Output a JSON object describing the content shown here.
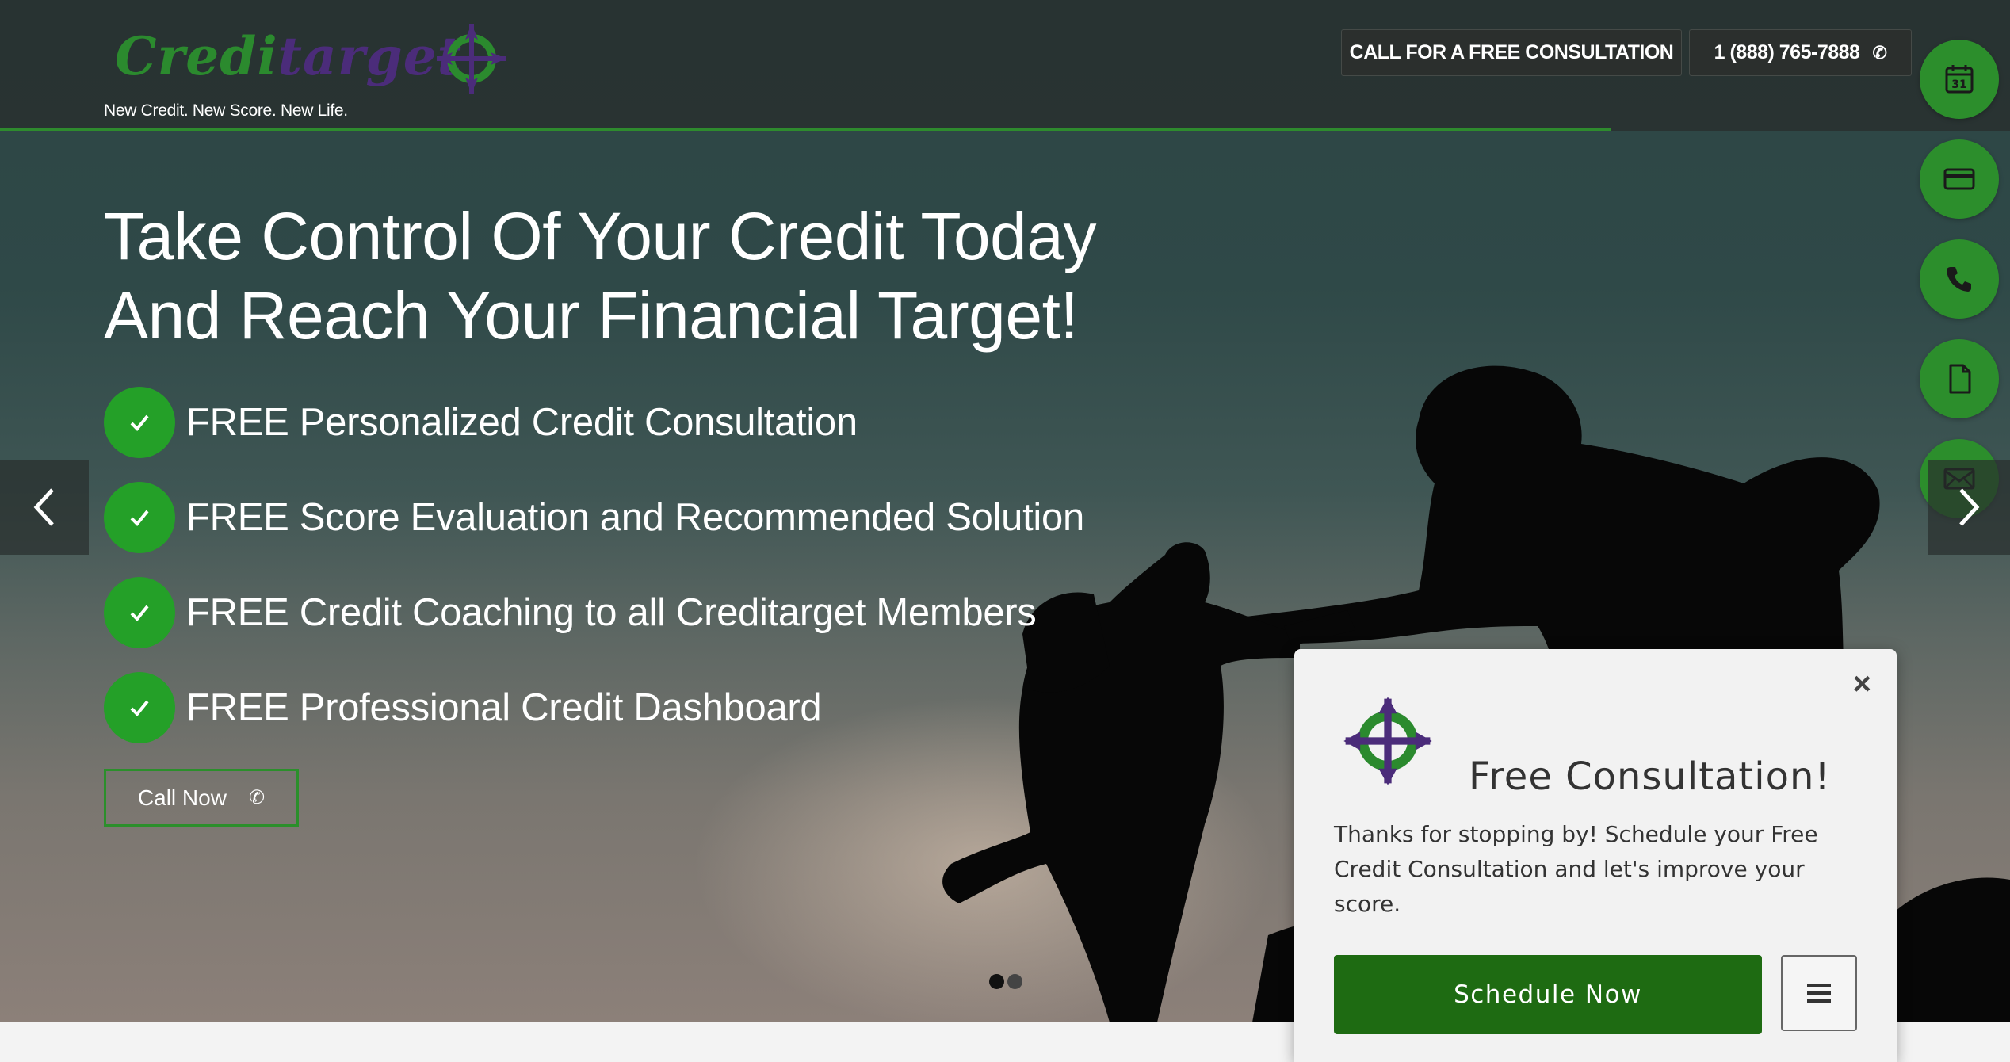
{
  "brand": {
    "logo_part1": "Credi",
    "logo_part2": "target",
    "tagline": "New Credit. New Score. New Life."
  },
  "header": {
    "consult_button": "CALL FOR A FREE CONSULTATION",
    "phone_button": "1 (888) 765-7888"
  },
  "float_actions": [
    {
      "icon": "calendar-icon",
      "day": "31"
    },
    {
      "icon": "credit-card-icon"
    },
    {
      "icon": "phone-icon"
    },
    {
      "icon": "document-icon"
    },
    {
      "icon": "envelope-icon"
    }
  ],
  "hero": {
    "headline_line1": "Take Control Of Your Credit Today",
    "headline_line2": "And Reach Your Financial Target!",
    "features": [
      "FREE Personalized Credit Consultation",
      "FREE Score Evaluation and Recommended Solution",
      "FREE Credit Coaching to all Creditarget Members",
      "FREE Professional Credit Dashboard"
    ],
    "cta_label": "Call Now",
    "slides": {
      "count": 2,
      "active": 1
    }
  },
  "popup": {
    "close_symbol": "×",
    "title": "Free Consultation!",
    "body": "Thanks for stopping by! Schedule your Free Credit Consultation and let's improve your score.",
    "button_label": "Schedule Now"
  },
  "colors": {
    "brand_green": "#2c8e2c",
    "brand_purple": "#4b2c7a",
    "schedule_green": "#1e6b12"
  }
}
